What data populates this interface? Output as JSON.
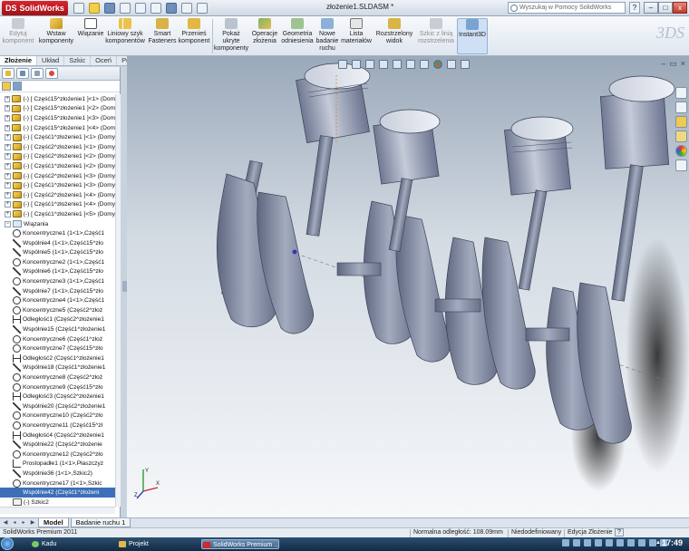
{
  "title_bar": {
    "app_name": "SolidWorks",
    "ds_mark": "DS",
    "document_title": "złożenie1.SLDASM *",
    "search_placeholder": "Wyszukaj w Pomocy SolidWorks",
    "help": "?",
    "minimize": "–",
    "maximize": "□",
    "close": "x"
  },
  "ribbon": {
    "buttons": [
      {
        "label": "Edytuj komponent",
        "disabled": true
      },
      {
        "label": "Wstaw komponenty",
        "disabled": false
      },
      {
        "label": "Wiązanie",
        "disabled": false
      },
      {
        "label": "Liniowy szyk komponentów",
        "disabled": false
      },
      {
        "label": "Smart Fasteners",
        "disabled": false
      },
      {
        "label": "Przenieś komponent",
        "disabled": false
      },
      {
        "label": "Pokaż ukryte komponenty",
        "disabled": false
      },
      {
        "label": "Operacje złożenia",
        "disabled": false
      },
      {
        "label": "Geometria odniesienia",
        "disabled": false
      },
      {
        "label": "Nowe badanie ruchu",
        "disabled": false
      },
      {
        "label": "Lista materiałów",
        "disabled": false
      },
      {
        "label": "Rozstrzelony widok",
        "disabled": false
      },
      {
        "label": "Szkic z linią rozstrzelenia",
        "disabled": true
      },
      {
        "label": "Instant3D",
        "disabled": false,
        "active": true
      }
    ],
    "watermark": "3DS"
  },
  "command_tabs": [
    {
      "label": "Złożenie",
      "active": true
    },
    {
      "label": "Układ",
      "active": false
    },
    {
      "label": "Szkic",
      "active": false
    },
    {
      "label": "Oceń",
      "active": false
    },
    {
      "label": "Produkty Office",
      "active": false
    }
  ],
  "tree": {
    "rows": [
      {
        "kind": "part",
        "text": "(-) [ Część15^złożenie1 ]<1> (Dom"
      },
      {
        "kind": "part",
        "text": "(-) [ Część15^złożenie1 ]<2> (Dom"
      },
      {
        "kind": "part",
        "text": "(-) [ Część15^złożenie1 ]<3> (Dom"
      },
      {
        "kind": "part",
        "text": "(-) [ Część15^złożenie1 ]<4> (Dom"
      },
      {
        "kind": "part",
        "text": "(-) [ Część1^złożenie1 ]<1> (Domy"
      },
      {
        "kind": "part",
        "text": "(-) [ Część2^złożenie1 ]<1> (Domy"
      },
      {
        "kind": "part",
        "text": "(-) [ Część2^złożenie1 ]<2> (Domy"
      },
      {
        "kind": "part",
        "text": "(-) [ Część1^złożenie1 ]<2> (Domy"
      },
      {
        "kind": "part",
        "text": "(-) [ Część2^złożenie1 ]<3> (Domy"
      },
      {
        "kind": "part",
        "text": "(-) [ Część1^złożenie1 ]<3> (Domy"
      },
      {
        "kind": "part",
        "text": "(-) [ Część2^złożenie1 ]<4> (Domy"
      },
      {
        "kind": "part",
        "text": "(-) [ Część1^złożenie1 ]<4> (Domy"
      },
      {
        "kind": "part",
        "text": "(-) [ Część1^złożenie1 ]<5> (Domy"
      },
      {
        "kind": "group",
        "text": "Wiązania"
      },
      {
        "kind": "mate",
        "icon": "concentric",
        "text": "Koncentryczne1 (1<1>,Część1"
      },
      {
        "kind": "mate",
        "icon": "coincident",
        "text": "Wspólnie4 (1<1>,Część15^zło"
      },
      {
        "kind": "mate",
        "icon": "coincident",
        "text": "Wspólnie5 (1<1>,Część15^zło"
      },
      {
        "kind": "mate",
        "icon": "concentric",
        "text": "Koncentryczne2 (1<1>,Część1"
      },
      {
        "kind": "mate",
        "icon": "coincident",
        "text": "Wspólnie6 (1<1>,Część15^zło"
      },
      {
        "kind": "mate",
        "icon": "concentric",
        "text": "Koncentryczne3 (1<1>,Część1"
      },
      {
        "kind": "mate",
        "icon": "coincident",
        "text": "Wspólnie7 (1<1>,Część15^zło"
      },
      {
        "kind": "mate",
        "icon": "concentric",
        "text": "Koncentryczne4 (1<1>,Część1"
      },
      {
        "kind": "mate",
        "icon": "concentric",
        "text": "Koncentryczne5 (Część2^złoż"
      },
      {
        "kind": "mate",
        "icon": "distance",
        "text": "Odległość1 (Część2^złożenie1"
      },
      {
        "kind": "mate",
        "icon": "coincident",
        "text": "Wspólnie15 (Część1^złożenie1"
      },
      {
        "kind": "mate",
        "icon": "concentric",
        "text": "Koncentryczne6 (Część1^złoż"
      },
      {
        "kind": "mate",
        "icon": "concentric",
        "text": "Koncentryczne7 (Część15^zło"
      },
      {
        "kind": "mate",
        "icon": "distance",
        "text": "Odległość2 (Część1^złożenie1"
      },
      {
        "kind": "mate",
        "icon": "coincident",
        "text": "Wspólnie18 (Część1^złożenie1"
      },
      {
        "kind": "mate",
        "icon": "concentric",
        "text": "Koncentryczne8 (Część2^złoż"
      },
      {
        "kind": "mate",
        "icon": "concentric",
        "text": "Koncentryczne9 (Część15^zło"
      },
      {
        "kind": "mate",
        "icon": "distance",
        "text": "Odległość3 (Część2^złożenie1"
      },
      {
        "kind": "mate",
        "icon": "coincident",
        "text": "Wspólnie20 (Część2^złożenie1"
      },
      {
        "kind": "mate",
        "icon": "concentric",
        "text": "Koncentryczne10 (Część2^zło"
      },
      {
        "kind": "mate",
        "icon": "concentric",
        "text": "Koncentryczne11 (Część15^zł"
      },
      {
        "kind": "mate",
        "icon": "distance",
        "text": "Odległość4 (Część2^złożenie1"
      },
      {
        "kind": "mate",
        "icon": "coincident",
        "text": "Wspólnie22 (Część2^złożenie"
      },
      {
        "kind": "mate",
        "icon": "concentric",
        "text": "Koncentryczne12 (Część2^zło"
      },
      {
        "kind": "mate",
        "icon": "perpendicular",
        "text": "Prostopadłe1 (1<1>,Płaszczyz"
      },
      {
        "kind": "mate",
        "icon": "coincident",
        "text": "Wspólnie36 (1<1>,Szkic2)"
      },
      {
        "kind": "mate",
        "icon": "concentric",
        "text": "Koncentryczne17 (1<1>,Szkic"
      },
      {
        "kind": "mate",
        "icon": "coincident",
        "text": "Wspólnie42 (Część1^złożeni",
        "selected": true
      },
      {
        "kind": "sketch",
        "text": "(-) Szkic2"
      }
    ]
  },
  "bottom_tabs": [
    {
      "label": "Model",
      "active": true
    },
    {
      "label": "Badanie ruchu 1",
      "active": false
    }
  ],
  "status_bar": {
    "product": "SolidWorks Premium 2011",
    "distance": "Normalna odległość: 108.09mm",
    "definition": "Niedodefiniowany",
    "mode": "Edycja Złożenie",
    "help": "?"
  },
  "taskbar": {
    "tasks": [
      {
        "label": "Kadu",
        "kind": "media"
      },
      {
        "label": "Projekt",
        "kind": "folder"
      },
      {
        "label": "SolidWorks Premium ...",
        "kind": "solidworks"
      }
    ],
    "clock": "17:49"
  },
  "triad": {
    "y_label": "Y",
    "x_label": "X",
    "z_label": "Z"
  },
  "colors": {
    "selection": "#3d6fb8",
    "brand": "#c7202a",
    "part_fill": "#8a93a8"
  }
}
